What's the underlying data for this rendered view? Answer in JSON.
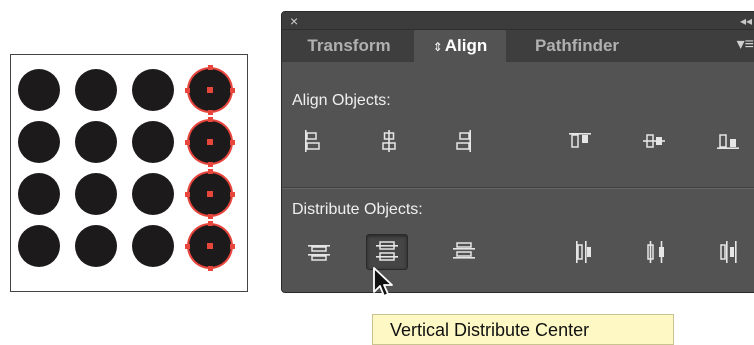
{
  "panel": {
    "close_glyph": "×",
    "collapse_glyph": "◂◂",
    "menu_glyph": "▾≡",
    "tabs": [
      {
        "label": "Transform",
        "active": false
      },
      {
        "label": "Align",
        "active": true,
        "prefix": "⇕"
      },
      {
        "label": "Pathfinder",
        "active": false
      }
    ],
    "align_objects": {
      "label": "Align Objects:",
      "buttons": [
        {
          "icon": "horizontal-align-left-icon"
        },
        {
          "icon": "horizontal-align-center-icon"
        },
        {
          "icon": "horizontal-align-right-icon"
        },
        {
          "icon": "vertical-align-top-icon"
        },
        {
          "icon": "vertical-align-center-icon"
        },
        {
          "icon": "vertical-align-bottom-icon"
        }
      ]
    },
    "distribute_objects": {
      "label": "Distribute Objects:",
      "buttons": [
        {
          "icon": "vertical-distribute-top-icon"
        },
        {
          "icon": "vertical-distribute-center-icon",
          "pressed": true
        },
        {
          "icon": "vertical-distribute-bottom-icon"
        },
        {
          "icon": "horizontal-distribute-left-icon"
        },
        {
          "icon": "horizontal-distribute-center-icon"
        },
        {
          "icon": "horizontal-distribute-right-icon"
        }
      ]
    }
  },
  "tooltip": {
    "text": "Vertical Distribute Center"
  },
  "artboard": {
    "rows": 4,
    "columns": 4,
    "selected_column": 4,
    "dot_color": "#1d1a1b",
    "selection_color": "#e8453c"
  },
  "colors": {
    "panel_bg": "#535353",
    "tab_bar_bg": "#3e3e3e",
    "tooltip_bg": "#fdf8c4"
  }
}
